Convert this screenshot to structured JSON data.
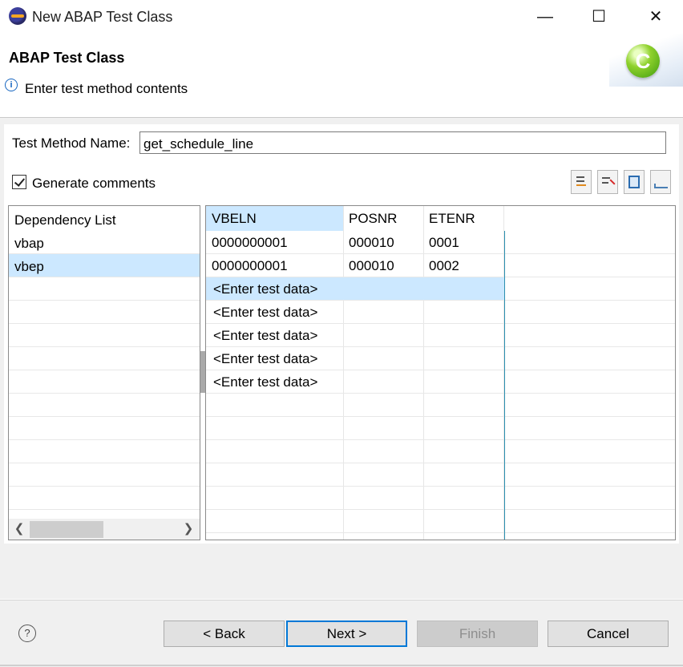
{
  "window": {
    "title": "New ABAP Test Class",
    "minimize_glyph": "—",
    "maximize_glyph": "☐",
    "close_glyph": "✕"
  },
  "header": {
    "title": "ABAP Test Class",
    "description": "Enter test method contents",
    "info_glyph": "i",
    "logo_glyph": "C"
  },
  "form": {
    "method_name_label": "Test Method Name:",
    "method_name_value": "get_schedule_line",
    "generate_comments_label": "Generate comments",
    "generate_comments_checked": true
  },
  "toolbar": {
    "icons": [
      "add-row-icon",
      "delete-row-icon",
      "columns-icon",
      "chart-icon"
    ]
  },
  "dependency_list": {
    "header": "Dependency List",
    "items": [
      "vbap",
      "vbep"
    ],
    "selected": "vbep"
  },
  "table": {
    "columns": [
      "VBELN",
      "POSNR",
      "ETENR"
    ],
    "rows": [
      [
        "0000000001",
        "000010",
        "0001"
      ],
      [
        "0000000001",
        "000010",
        "0002"
      ],
      [
        "<Enter test data>",
        "",
        ""
      ],
      [
        "<Enter test data>",
        "",
        ""
      ],
      [
        "<Enter test data>",
        "",
        ""
      ],
      [
        "<Enter test data>",
        "",
        ""
      ],
      [
        "<Enter test data>",
        "",
        ""
      ]
    ]
  },
  "footer": {
    "help_glyph": "?",
    "back_label": "< Back",
    "next_label": "Next >",
    "finish_label": "Finish",
    "cancel_label": "Cancel"
  },
  "colors": {
    "selection": "#cce8ff",
    "accent": "#0078d7",
    "info": "#1565c0"
  }
}
